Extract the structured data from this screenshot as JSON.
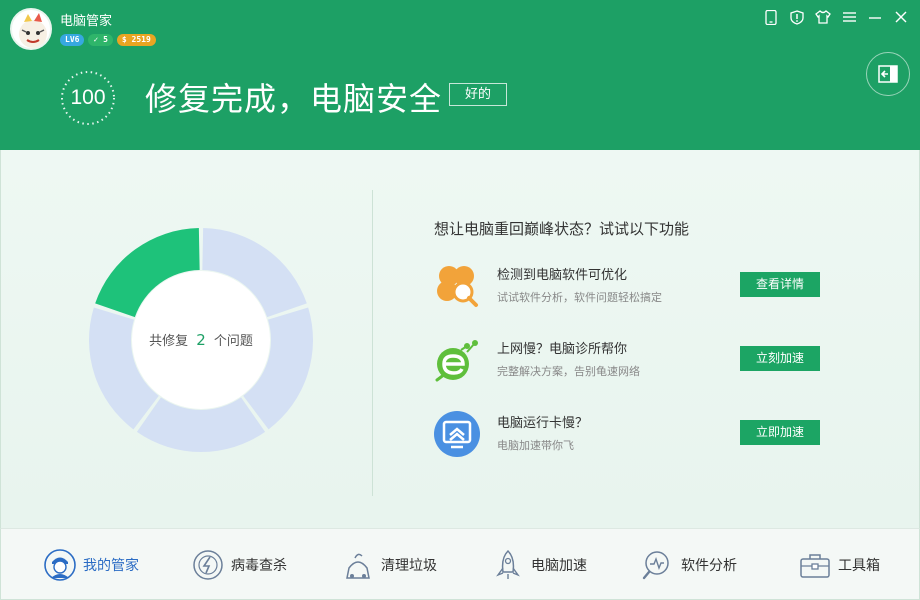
{
  "app": {
    "title": "电脑管家",
    "level_badge": "LV6",
    "check_badge": "✓ 5",
    "coin_badge": "$ 2519"
  },
  "header": {
    "score": "100",
    "status_title": "修复完成，电脑安全",
    "ok_button": "好的",
    "bg_color": "#1da065"
  },
  "summary": {
    "prefix": "共修复",
    "count": "2",
    "suffix": "个问题",
    "fixed_fraction": 0.2
  },
  "suggestions": {
    "heading": "想让电脑重回巅峰状态？试试以下功能",
    "items": [
      {
        "icon": "clover-search-icon",
        "title": "检测到电脑软件可优化",
        "desc": "试试软件分析，软件问题轻松搞定",
        "button": "查看详情"
      },
      {
        "icon": "network-bug-e-icon",
        "title": "上网慢？电脑诊所帮你",
        "desc": "完整解决方案，告别龟速网络",
        "button": "立刻加速"
      },
      {
        "icon": "monitor-speed-icon",
        "title": "电脑运行卡慢？",
        "desc": "电脑加速带你飞",
        "button": "立即加速"
      }
    ]
  },
  "nav": [
    {
      "icon": "butler-icon",
      "label": "我的管家",
      "active": true
    },
    {
      "icon": "virus-scan-icon",
      "label": "病毒查杀",
      "active": false
    },
    {
      "icon": "cleanup-icon",
      "label": "清理垃圾",
      "active": false
    },
    {
      "icon": "rocket-icon",
      "label": "电脑加速",
      "active": false
    },
    {
      "icon": "software-analysis-icon",
      "label": "软件分析",
      "active": false
    },
    {
      "icon": "toolbox-icon",
      "label": "工具箱",
      "active": false
    }
  ],
  "colors": {
    "accent": "#1ca564",
    "donut_fixed": "#1ec27a",
    "donut_rest": "#d4e0f4",
    "nav_active": "#2b6cc4"
  }
}
